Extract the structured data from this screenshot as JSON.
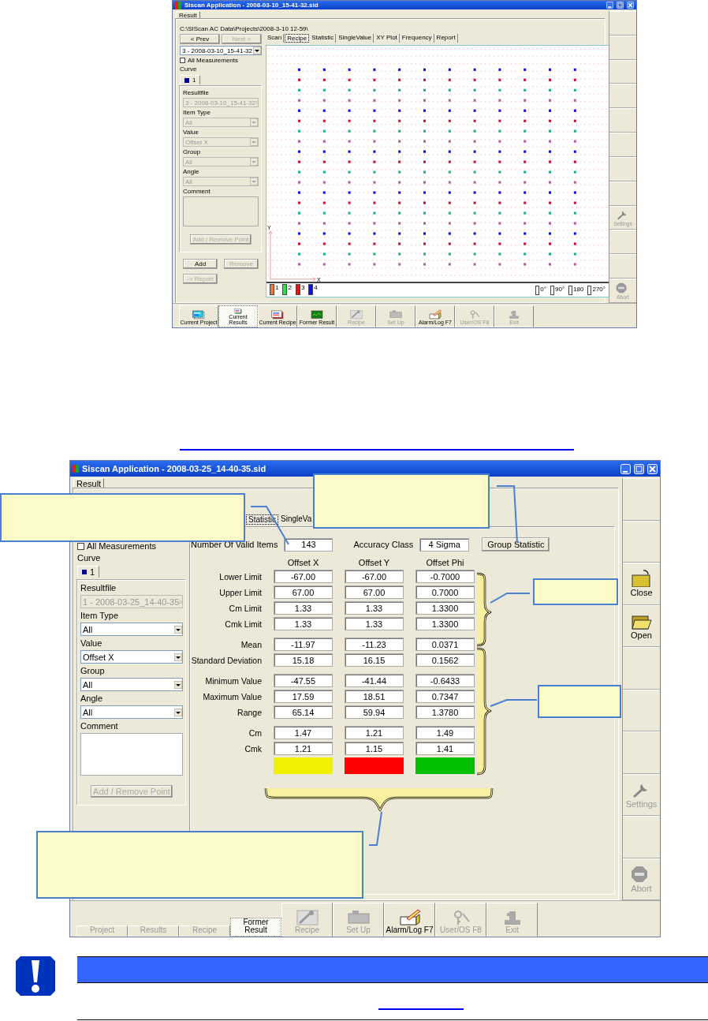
{
  "screens": [
    {
      "title": "Siscan Application - 2008-03-10_15-41-32.sid",
      "page_tab": "Result",
      "path": "C:\\SIScan AC Data\\Projects\\2008-3-10 12-59\\",
      "left_panel": {
        "nav": [
          {
            "label": "< Prev",
            "disabled": false
          },
          {
            "label": "Next >",
            "disabled": true
          }
        ],
        "result": "3 - 2008-03-10_15-41-32",
        "all_measurements": {
          "label": "All Measurements",
          "checked": false
        },
        "curve": {
          "label": "Curve",
          "tab": "1"
        },
        "fields": [
          {
            "label": "Resultfile",
            "value": "3 - 2008-03-10_15-41-32",
            "disabled": true
          },
          {
            "label": "Item Type",
            "value": "All",
            "disabled": true
          },
          {
            "label": "Value",
            "value": "Offset X",
            "disabled": true
          },
          {
            "label": "Group",
            "value": "All",
            "disabled": true
          },
          {
            "label": "Angle",
            "value": "All",
            "disabled": true
          }
        ],
        "comment": "Comment",
        "point_button": {
          "label": "Add / Remove Point",
          "disabled": true
        },
        "buttons": [
          {
            "label": "Add",
            "disabled": false
          },
          {
            "label": "Remove",
            "disabled": true
          },
          {
            "label": "-> Report",
            "disabled": true
          }
        ]
      },
      "view_tabs": [
        {
          "label": "Scan",
          "selected": false
        },
        {
          "label": "Recipe",
          "selected": true
        },
        {
          "label": "Statistic",
          "selected": false
        },
        {
          "label": "SingleValue",
          "selected": false
        },
        {
          "label": "XY Plot",
          "selected": false
        },
        {
          "label": "Frequency",
          "selected": false
        },
        {
          "label": "Report",
          "selected": false
        }
      ],
      "view": {
        "kind": "plot",
        "y_label": "Y",
        "x_label": "X",
        "legend": [
          {
            "label": "1",
            "color": "#f07838"
          },
          {
            "label": "2",
            "color": "#30e050"
          },
          {
            "label": "3",
            "color": "#ee1111"
          },
          {
            "label": "4",
            "color": "#1010ee"
          }
        ],
        "angles": [
          "0°",
          "90°",
          "180",
          "270°"
        ]
      },
      "side_buttons": [
        {
          "kind": "blank"
        },
        {
          "kind": "blank"
        },
        {
          "kind": "blank"
        },
        {
          "kind": "blank"
        },
        {
          "kind": "blank"
        },
        {
          "kind": "blank"
        },
        {
          "kind": "blank"
        },
        {
          "kind": "blank"
        },
        {
          "kind": "settings",
          "label": "Settings",
          "disabled": true
        },
        {
          "kind": "blank"
        },
        {
          "kind": "blank"
        },
        {
          "kind": "abort",
          "label": "Abort",
          "disabled": true
        }
      ],
      "toolbar": [
        {
          "kind": "project",
          "label": "Current Project",
          "disabled": false,
          "selected": false
        },
        {
          "kind": "results",
          "label": "Current Results",
          "disabled": false,
          "selected": true
        },
        {
          "kind": "recipe",
          "label": "Current Recipe",
          "disabled": false,
          "selected": false
        },
        {
          "kind": "former",
          "label": "Former Result",
          "disabled": false,
          "selected": false
        },
        {
          "kind": "tools",
          "label": "Recipe",
          "disabled": true,
          "selected": false
        },
        {
          "kind": "setup",
          "label": "Set Up",
          "disabled": true,
          "selected": false
        },
        {
          "kind": "alarm",
          "label": "Alarm/Log F7",
          "disabled": false,
          "selected": false
        },
        {
          "kind": "keys",
          "label": "User/OS F8",
          "disabled": true,
          "selected": false
        },
        {
          "kind": "exit",
          "label": "Exit",
          "disabled": true,
          "selected": false
        }
      ]
    },
    {
      "title": "Siscan Application - 2008-03-25_14-40-35.sid",
      "page_tab": "Result",
      "left_panel": {
        "all_measurements": {
          "label": "All Measurements",
          "checked": false
        },
        "curve": {
          "label": "Curve",
          "tab": "1"
        },
        "fields": [
          {
            "label": "Resultfile",
            "value": "1 - 2008-03-25_14-40-35",
            "disabled": true
          },
          {
            "label": "Item Type",
            "value": "All",
            "disabled": false
          },
          {
            "label": "Value",
            "value": "Offset X",
            "disabled": false
          },
          {
            "label": "Group",
            "value": "All",
            "disabled": false
          },
          {
            "label": "Angle",
            "value": "All",
            "disabled": false
          }
        ],
        "comment": "Comment",
        "point_button": {
          "label": "Add / Remove Point",
          "disabled": true
        }
      },
      "view_tabs": [
        {
          "label": "Statistic",
          "selected": true
        },
        {
          "label": "SingleVa",
          "selected": false
        }
      ],
      "view": {
        "kind": "statistic",
        "valid_items": {
          "label": "Number Of Valid Items",
          "value": "143"
        },
        "accuracy": {
          "label": "Accuracy Class",
          "value": "4 Sigma"
        },
        "group_button": "Group Statistic",
        "columns": [
          "Offset X",
          "Offset Y",
          "Offset Phi"
        ],
        "groups": [
          [
            {
              "label": "Lower Limit",
              "values": [
                "-67.00",
                "-67.00",
                "-0.7000"
              ]
            },
            {
              "label": "Upper Limit",
              "values": [
                "67.00",
                "67.00",
                "0.7000"
              ]
            },
            {
              "label": "Cm Limit",
              "values": [
                "1.33",
                "1.33",
                "1.3300"
              ]
            },
            {
              "label": "Cmk Limit",
              "values": [
                "1.33",
                "1.33",
                "1.3300"
              ]
            }
          ],
          [
            {
              "label": "Mean",
              "values": [
                "-11.97",
                "-11.23",
                "0.0371"
              ]
            },
            {
              "label": "Standard Deviation",
              "values": [
                "15.18",
                "16.15",
                "0.1562"
              ]
            }
          ],
          [
            {
              "label": "Minimum Value",
              "values": [
                "-47.55",
                "-41.44",
                "-0.6433"
              ]
            },
            {
              "label": "Maximum Value",
              "values": [
                "17.59",
                "18.51",
                "0.7347"
              ]
            },
            {
              "label": "Range",
              "values": [
                "65.14",
                "59.94",
                "1.3780"
              ]
            }
          ],
          [
            {
              "label": "Cm",
              "values": [
                "1.47",
                "1.21",
                "1.49"
              ]
            },
            {
              "label": "Cmk",
              "values": [
                "1.21",
                "1.15",
                "1.41"
              ]
            }
          ]
        ],
        "indicators": [
          {
            "color": "#f0f000"
          },
          {
            "color": "#ff0000"
          },
          {
            "color": "#00c000"
          }
        ]
      },
      "side_buttons": [
        {
          "kind": "blank"
        },
        {
          "kind": "blank"
        },
        {
          "kind": "close",
          "label": "Close",
          "disabled": false
        },
        {
          "kind": "open",
          "label": "Open",
          "disabled": false
        },
        {
          "kind": "blank"
        },
        {
          "kind": "blank"
        },
        {
          "kind": "blank"
        },
        {
          "kind": "settings",
          "label": "Settings",
          "disabled": true
        },
        {
          "kind": "blank"
        },
        {
          "kind": "abort",
          "label": "Abort",
          "disabled": true
        }
      ],
      "toolbar": [
        {
          "label": "Project",
          "disabled": true,
          "selected": false
        },
        {
          "label": "Results",
          "disabled": true,
          "selected": false
        },
        {
          "label": "Recipe",
          "disabled": true,
          "selected": false
        },
        {
          "label": "Former Result",
          "disabled": false,
          "selected": true
        },
        {
          "kind": "tools",
          "label": "Recipe",
          "disabled": true,
          "selected": false
        },
        {
          "kind": "setup",
          "label": "Set Up",
          "disabled": true,
          "selected": false
        },
        {
          "kind": "alarm",
          "label": "Alarm/Log F7",
          "disabled": false,
          "selected": false
        },
        {
          "kind": "keys",
          "label": "User/OS F8",
          "disabled": true,
          "selected": false
        },
        {
          "kind": "exit",
          "label": "Exit",
          "disabled": true,
          "selected": false
        }
      ]
    }
  ],
  "callouts": [
    {
      "kind": "box"
    },
    {
      "kind": "box"
    },
    {
      "kind": "box"
    },
    {
      "kind": "box"
    },
    {
      "kind": "box"
    },
    {
      "kind": "brace"
    },
    {
      "kind": "brace"
    },
    {
      "kind": "brace"
    }
  ],
  "note": {
    "kind": "important"
  }
}
